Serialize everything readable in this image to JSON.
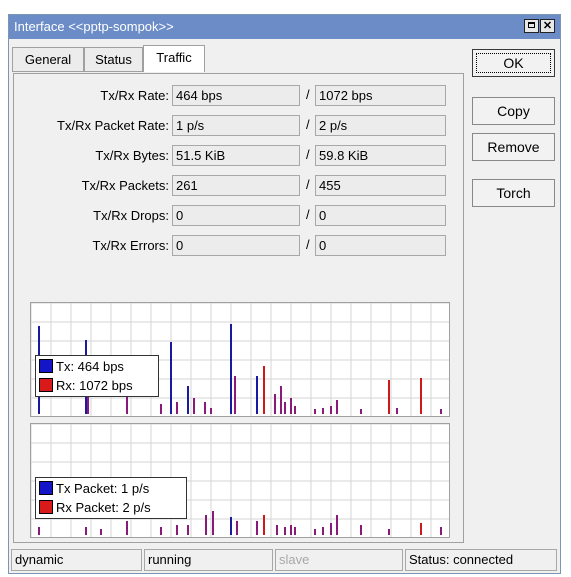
{
  "window": {
    "title": "Interface <<pptp-sompok>>"
  },
  "tabs": [
    {
      "label": "General"
    },
    {
      "label": "Status"
    },
    {
      "label": "Traffic",
      "active": true
    }
  ],
  "rows": [
    {
      "label": "Tx/Rx Rate:",
      "tx": "464 bps",
      "rx": "1072 bps"
    },
    {
      "label": "Tx/Rx Packet Rate:",
      "tx": "1 p/s",
      "rx": "2 p/s"
    },
    {
      "label": "Tx/Rx Bytes:",
      "tx": "51.5 KiB",
      "rx": "59.8 KiB"
    },
    {
      "label": "Tx/Rx Packets:",
      "tx": "261",
      "rx": "455"
    },
    {
      "label": "Tx/Rx Drops:",
      "tx": "0",
      "rx": "0"
    },
    {
      "label": "Tx/Rx Errors:",
      "tx": "0",
      "rx": "0"
    }
  ],
  "separator": "/",
  "buttons": {
    "ok": "OK",
    "copy": "Copy",
    "remove": "Remove",
    "torch": "Torch"
  },
  "graphs": {
    "traffic": {
      "tx_legend": "Tx:  464 bps",
      "rx_legend": "Rx:  1072 bps"
    },
    "packets": {
      "tx_legend": "Tx Packet:  1 p/s",
      "rx_legend": "Rx Packet:  2 p/s"
    }
  },
  "colors": {
    "tx": "#1a1aa0",
    "rx": "#cc1a1a",
    "titlebar": "#6b8cc7"
  },
  "statusbar": {
    "cell1": "dynamic",
    "cell2": "running",
    "cell3": "slave",
    "cell4": "Status: connected"
  }
}
